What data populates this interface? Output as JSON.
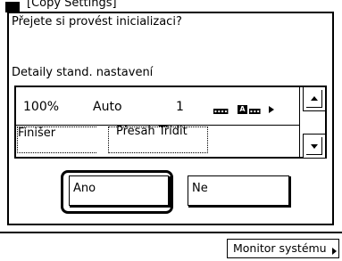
{
  "background_window": {
    "title": "[Copy Settings]"
  },
  "dialog": {
    "question": "Přejete si provést inicializaci?",
    "details_label": "Detaily stand. nastavení",
    "settings": {
      "zoom": "100%",
      "paper": "Auto",
      "copies": "1",
      "density_marker": "A",
      "finisher": "Finišer",
      "sort": "Přesah Třídit"
    },
    "buttons": {
      "yes": "Ano",
      "no": "Ne"
    }
  },
  "statusbar": {
    "monitor_label": "Monitor systému"
  }
}
